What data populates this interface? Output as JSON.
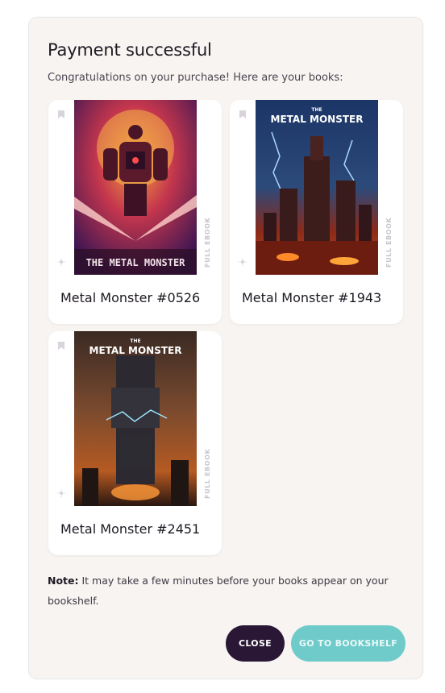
{
  "dialog": {
    "title": "Payment successful",
    "subtitle": "Congratulations on your purchase! Here are your books:",
    "note_label": "Note:",
    "note_text": " It may take a few minutes before your books appear on your bookshelf."
  },
  "books": [
    {
      "title": "Metal Monster #0526",
      "format": "FULL EBOOK",
      "cover_text": "THE METAL MONSTER"
    },
    {
      "title": "Metal Monster #1943",
      "format": "FULL EBOOK",
      "cover_text_small": "THE",
      "cover_text": "METAL MONSTER"
    },
    {
      "title": "Metal Monster #2451",
      "format": "FULL EBOOK",
      "cover_text_small": "THE",
      "cover_text": "METAL MONSTER"
    }
  ],
  "buttons": {
    "close": "CLOSE",
    "go_to_bookshelf": "GO TO BOOKSHELF"
  },
  "colors": {
    "modal_bg": "#f8f4f1",
    "close_button": "#2a1736",
    "bookshelf_button": "#6ecbca"
  },
  "icons": [
    "bookmark-icon",
    "sun-icon"
  ]
}
